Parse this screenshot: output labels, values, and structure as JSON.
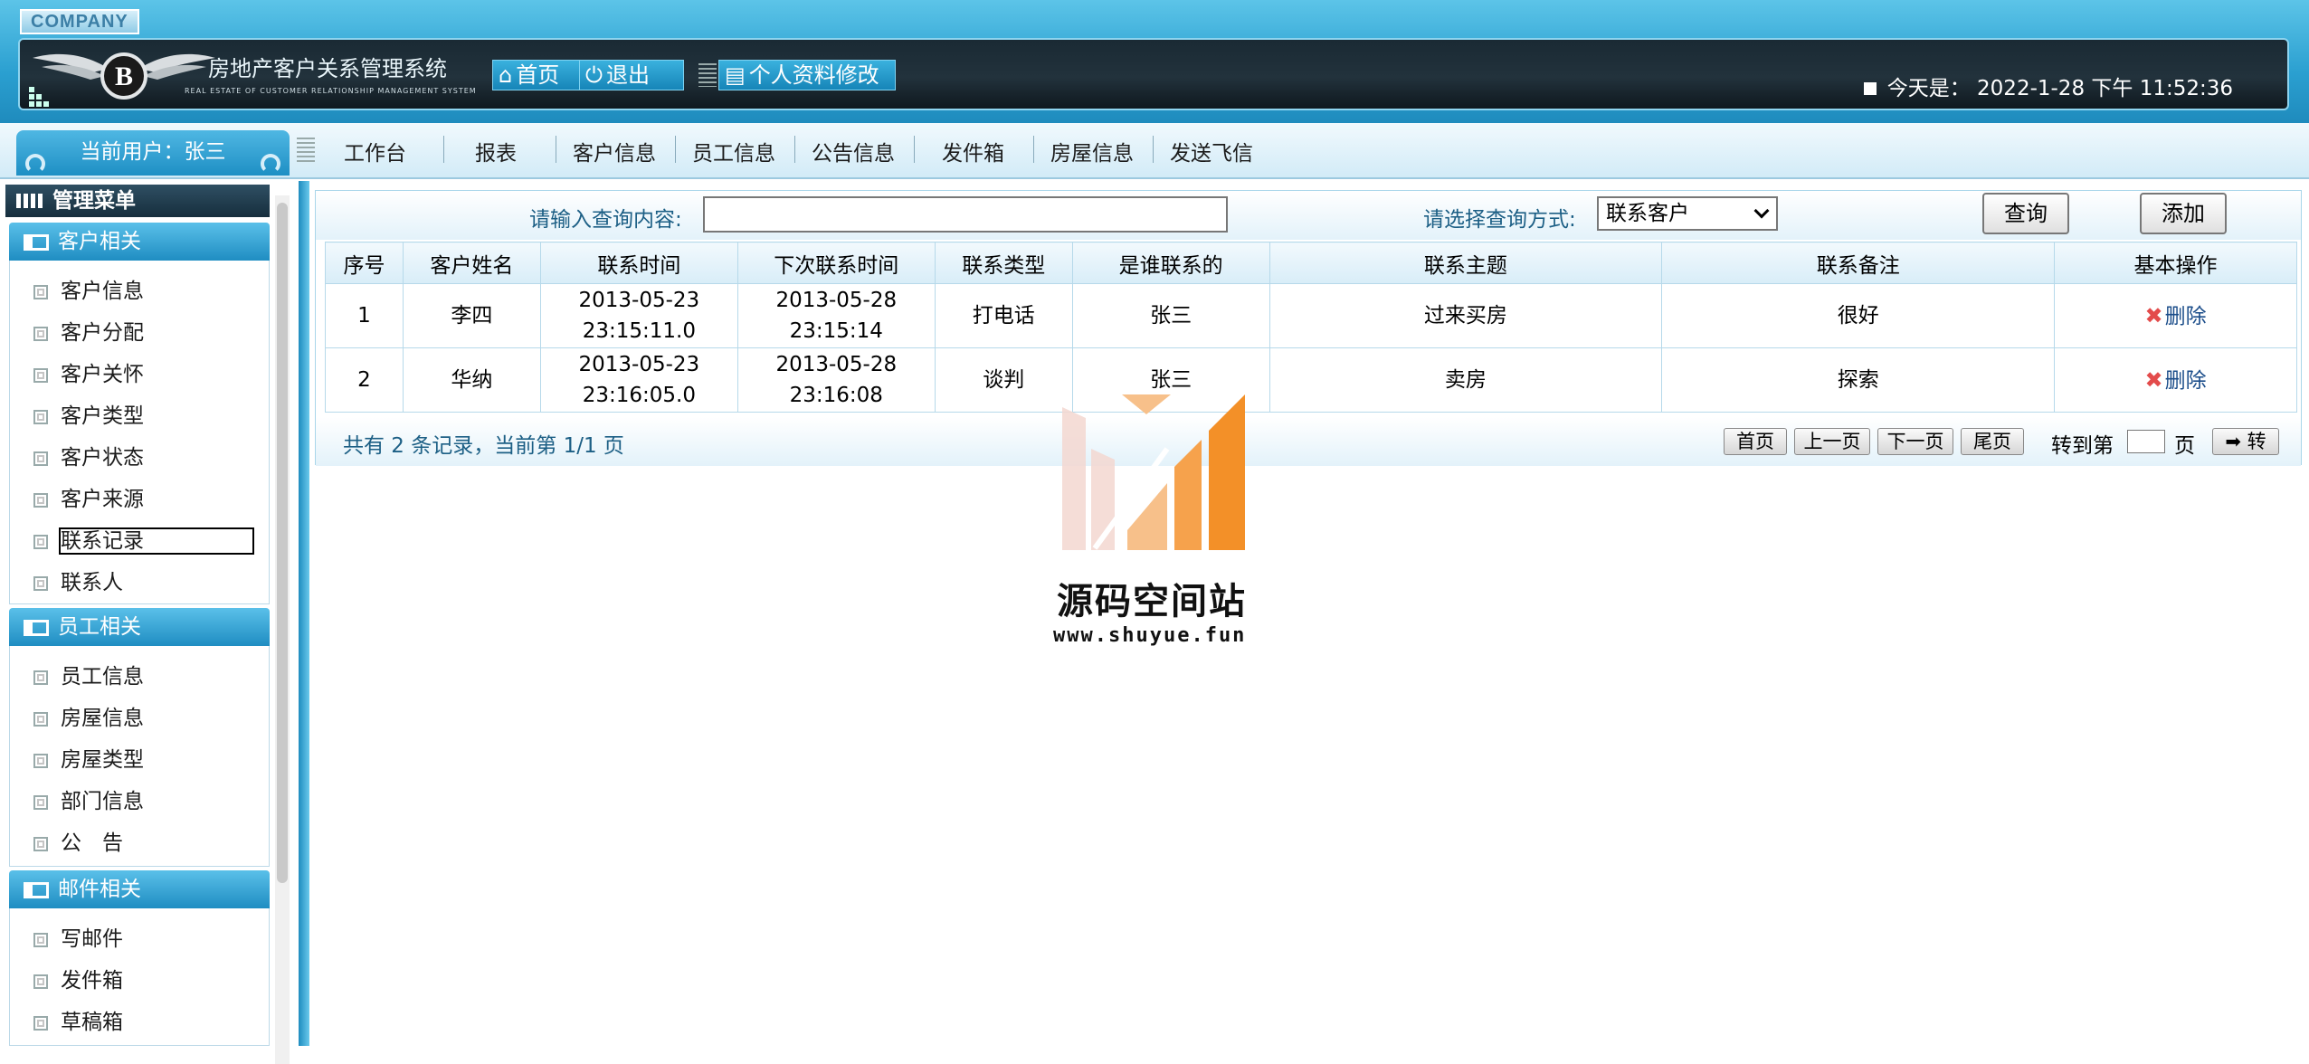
{
  "header": {
    "company": "COMPANY",
    "system_title": "房地产客户关系管理系统",
    "system_subtitle": "REAL ESTATE OF CUSTOMER RELATIONSHIP MANAGEMENT SYSTEM",
    "home_label": "首页",
    "logout_label": "退出",
    "profile_label": "个人资料修改",
    "datetime": "今天是：  2022-1-28 下午 11:52:36"
  },
  "nav": {
    "current_user": "当前用户：张三",
    "items": [
      "工作台",
      "报表",
      "客户信息",
      "员工信息",
      "公告信息",
      "发件箱",
      "房屋信息",
      "发送飞信"
    ]
  },
  "sidebar": {
    "title": "管理菜单",
    "groups": [
      {
        "title": "客户相关",
        "items": [
          "客户信息",
          "客户分配",
          "客户关怀",
          "客户类型",
          "客户状态",
          "客户来源",
          "联系记录",
          "联系人"
        ]
      },
      {
        "title": "员工相关",
        "items": [
          "员工信息",
          "房屋信息",
          "房屋类型",
          "部门信息",
          "公　告"
        ]
      },
      {
        "title": "邮件相关",
        "items": [
          "写邮件",
          "发件箱",
          "草稿箱"
        ]
      }
    ],
    "selected": "联系记录"
  },
  "search": {
    "prompt_label": "请输入查询内容:",
    "input_value": "",
    "mode_label": "请选择查询方式:",
    "mode_selected": "联系客户",
    "query_label": "查询",
    "add_label": "添加"
  },
  "table": {
    "columns": [
      "序号",
      "客户姓名",
      "联系时间",
      "下次联系时间",
      "联系类型",
      "是谁联系的",
      "联系主题",
      "联系备注",
      "基本操作"
    ],
    "rows": [
      {
        "no": "1",
        "customer": "李四",
        "time_date": "2013-05-23",
        "time_clock": "23:15:11.0",
        "next_date": "2013-05-28",
        "next_clock": "23:15:14",
        "type": "打电话",
        "who": "张三",
        "subject": "过来买房",
        "remark": "很好",
        "action": "删除"
      },
      {
        "no": "2",
        "customer": "华纳",
        "time_date": "2013-05-23",
        "time_clock": "23:16:05.0",
        "next_date": "2013-05-28",
        "next_clock": "23:16:08",
        "type": "谈判",
        "who": "张三",
        "subject": "卖房",
        "remark": "探索",
        "action": "删除"
      }
    ]
  },
  "pager": {
    "info": "共有 2 条记录，当前第 1/1 页",
    "first": "首页",
    "prev": "上一页",
    "next": "下一页",
    "last": "尾页",
    "jump_label": "转到第",
    "jump_unit": "页",
    "go_label": "➡ 转"
  },
  "watermark": {
    "name": "源码空间站",
    "url": "www.shuyue.fun"
  },
  "colors": {
    "header_blue": "#2a9fd0",
    "head_bar": "#1a2a34",
    "label_blue": "#1c5f85",
    "delete_red": "#e34b4b",
    "watermark_orange": "#f5a14a"
  }
}
